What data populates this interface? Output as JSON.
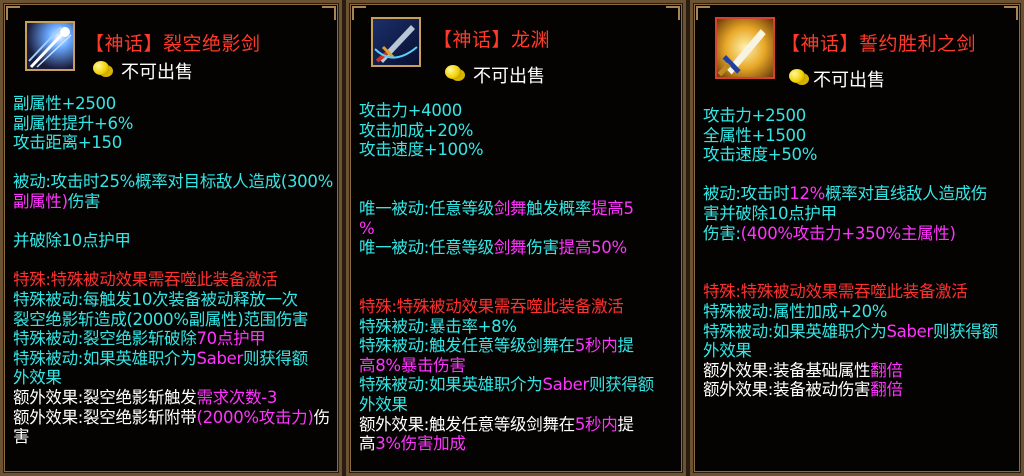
{
  "items": [
    {
      "title": "【神话】裂空绝影剑",
      "sell_text": "不可出售",
      "icon": "sword-slash-icon",
      "lines": [
        [
          {
            "t": "副属性+2500",
            "c": "cyan"
          }
        ],
        [
          {
            "t": "副属性提升+6%",
            "c": "cyan"
          }
        ],
        [
          {
            "t": "攻击距离+150",
            "c": "cyan"
          }
        ],
        [],
        [
          {
            "t": "被动:攻击时25%概率对目标敌人造成(300%",
            "c": "cyan"
          }
        ],
        [
          {
            "t": "副属性)",
            "c": "mag"
          },
          {
            "t": "伤害",
            "c": "cyan"
          }
        ],
        [],
        [
          {
            "t": "并破除10点护甲",
            "c": "cyan"
          }
        ],
        [],
        [
          {
            "t": "特殊:特殊被动效果需吞噬此装备激活",
            "c": "red"
          }
        ],
        [
          {
            "t": "特殊被动:每触发10次装备被动释放一次",
            "c": "cyan"
          }
        ],
        [
          {
            "t": "裂空绝影斩造成(2000%副属性)",
            "c": "cyan"
          },
          {
            "t": "范围伤害",
            "c": "cyan"
          }
        ],
        [
          {
            "t": "特殊被动:裂空绝影斩破除",
            "c": "cyan"
          },
          {
            "t": "70点护甲",
            "c": "mag"
          }
        ],
        [
          {
            "t": "特殊被动:如果英雄职介为",
            "c": "cyan"
          },
          {
            "t": "Saber",
            "c": "mag"
          },
          {
            "t": "则获得额",
            "c": "cyan"
          }
        ],
        [
          {
            "t": "外效果",
            "c": "cyan"
          }
        ],
        [
          {
            "t": "额外效果:裂空绝影斩触发",
            "c": "wht"
          },
          {
            "t": "需求次数-3",
            "c": "mag"
          }
        ],
        [
          {
            "t": "额外效果:裂空绝影斩附带",
            "c": "wht"
          },
          {
            "t": "(2000%攻击力)",
            "c": "mag"
          },
          {
            "t": "伤",
            "c": "wht"
          }
        ],
        [
          {
            "t": "害",
            "c": "wht"
          }
        ]
      ]
    },
    {
      "title": "【神话】龙渊",
      "sell_text": "不可出售",
      "icon": "dragon-blade-icon",
      "lines": [
        [
          {
            "t": "攻击力+4000",
            "c": "cyan"
          }
        ],
        [
          {
            "t": "攻击加成+20%",
            "c": "cyan"
          }
        ],
        [
          {
            "t": "攻击速度+100%",
            "c": "cyan"
          }
        ],
        [],
        [],
        [
          {
            "t": "唯一被动:任意等级",
            "c": "cyan"
          },
          {
            "t": "剑舞",
            "c": "mag"
          },
          {
            "t": "触发概率",
            "c": "cyan"
          },
          {
            "t": "提高5",
            "c": "mag"
          }
        ],
        [
          {
            "t": "%",
            "c": "mag"
          }
        ],
        [
          {
            "t": "唯一被动:任意等级",
            "c": "cyan"
          },
          {
            "t": "剑舞",
            "c": "mag"
          },
          {
            "t": "伤害",
            "c": "cyan"
          },
          {
            "t": "提高50%",
            "c": "mag"
          }
        ],
        [],
        [],
        [
          {
            "t": "特殊:特殊被动效果需吞噬此装备激活",
            "c": "red"
          }
        ],
        [
          {
            "t": "特殊被动:暴击率+8%",
            "c": "cyan"
          }
        ],
        [
          {
            "t": "特殊被动:触发任意等级剑舞在",
            "c": "cyan"
          },
          {
            "t": "5秒内",
            "c": "mag"
          },
          {
            "t": "提",
            "c": "cyan"
          }
        ],
        [
          {
            "t": "高8%暴击伤害",
            "c": "mag"
          }
        ],
        [
          {
            "t": "特殊被动:如果英雄职介为",
            "c": "cyan"
          },
          {
            "t": "Saber",
            "c": "mag"
          },
          {
            "t": "则获得额",
            "c": "cyan"
          }
        ],
        [
          {
            "t": "外效果",
            "c": "cyan"
          }
        ],
        [
          {
            "t": "额外效果:触发任意等级剑舞在",
            "c": "wht"
          },
          {
            "t": "5秒内",
            "c": "mag"
          },
          {
            "t": "提",
            "c": "wht"
          }
        ],
        [
          {
            "t": "高",
            "c": "wht"
          },
          {
            "t": "3%",
            "c": "mag"
          },
          {
            "t": "伤害加成",
            "c": "mag"
          }
        ]
      ]
    },
    {
      "title": "【神话】誓约胜利之剑",
      "sell_text": "不可出售",
      "icon": "excalibur-icon",
      "lines": [
        [
          {
            "t": "攻击力+2500",
            "c": "cyan"
          }
        ],
        [
          {
            "t": "全属性+1500",
            "c": "cyan"
          }
        ],
        [
          {
            "t": "攻击速度+50%",
            "c": "cyan"
          }
        ],
        [],
        [
          {
            "t": "被动:攻击时",
            "c": "cyan"
          },
          {
            "t": "12%",
            "c": "mag"
          },
          {
            "t": "概率对直线敌人造成伤",
            "c": "cyan"
          }
        ],
        [
          {
            "t": "害并破除10点护甲",
            "c": "cyan"
          }
        ],
        [
          {
            "t": "伤害:",
            "c": "cyan"
          },
          {
            "t": "(400%攻击力+350%主属性)",
            "c": "mag"
          }
        ],
        [],
        [],
        [
          {
            "t": "特殊:特殊被动效果需吞噬此装备激活",
            "c": "red"
          }
        ],
        [
          {
            "t": "特殊被动:属性加成+20%",
            "c": "cyan"
          }
        ],
        [
          {
            "t": "特殊被动:如果英雄职介为",
            "c": "cyan"
          },
          {
            "t": "Saber",
            "c": "mag"
          },
          {
            "t": "则获得额",
            "c": "cyan"
          }
        ],
        [
          {
            "t": "外效果",
            "c": "cyan"
          }
        ],
        [
          {
            "t": "额外效果:装备基础属性",
            "c": "wht"
          },
          {
            "t": "翻倍",
            "c": "mag"
          }
        ],
        [
          {
            "t": "额外效果:装备被动伤害",
            "c": "wht"
          },
          {
            "t": "翻倍",
            "c": "mag"
          }
        ]
      ]
    }
  ]
}
